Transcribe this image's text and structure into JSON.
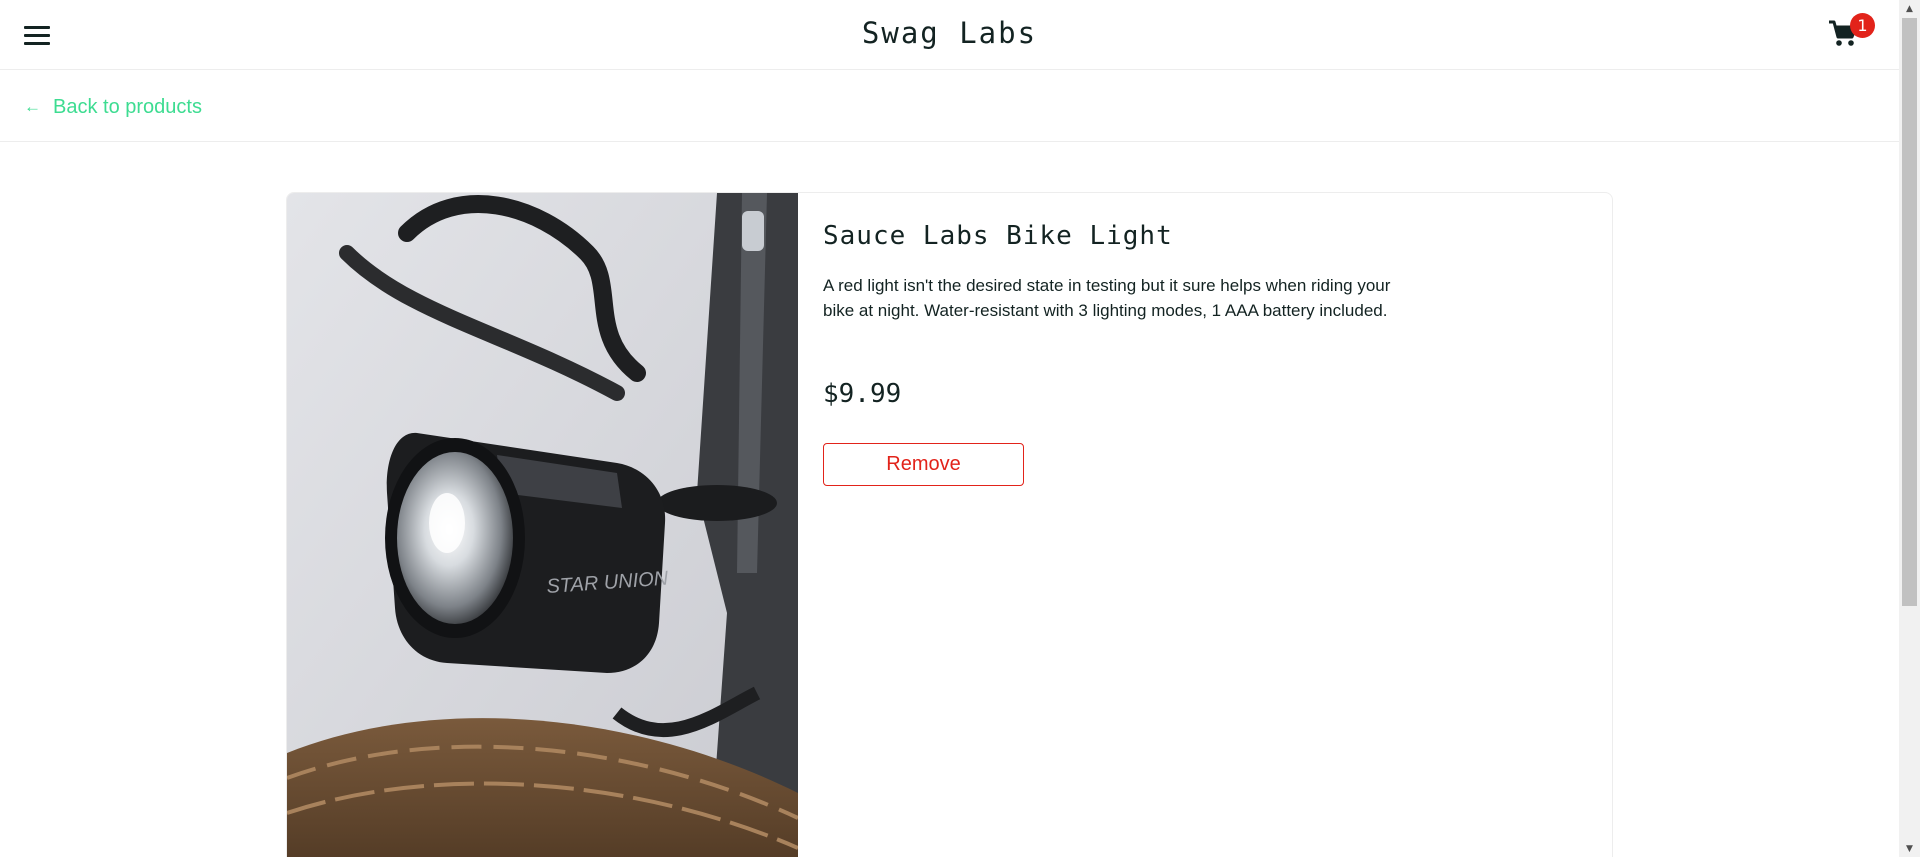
{
  "header": {
    "app_logo": "Swag Labs",
    "menu_icon": "hamburger-menu-icon",
    "cart_icon": "shopping-cart-icon",
    "cart_count": "1"
  },
  "sub_header": {
    "back_label": "Back to products",
    "back_icon": "arrow-left-icon"
  },
  "product": {
    "name": "Sauce Labs Bike Light",
    "description": "A red light isn't the desired state in testing but it sure helps when riding your bike at night. Water-resistant with 3 lighting modes, 1 AAA battery included.",
    "price": "$9.99",
    "action_label": "Remove",
    "image_alt": "Sauce Labs Bike Light",
    "image_lettering": "STAR UNION"
  },
  "colors": {
    "accent_green": "#3ddc91",
    "remove_red": "#e2231a",
    "text_dark": "#132322",
    "border": "#ededed"
  }
}
